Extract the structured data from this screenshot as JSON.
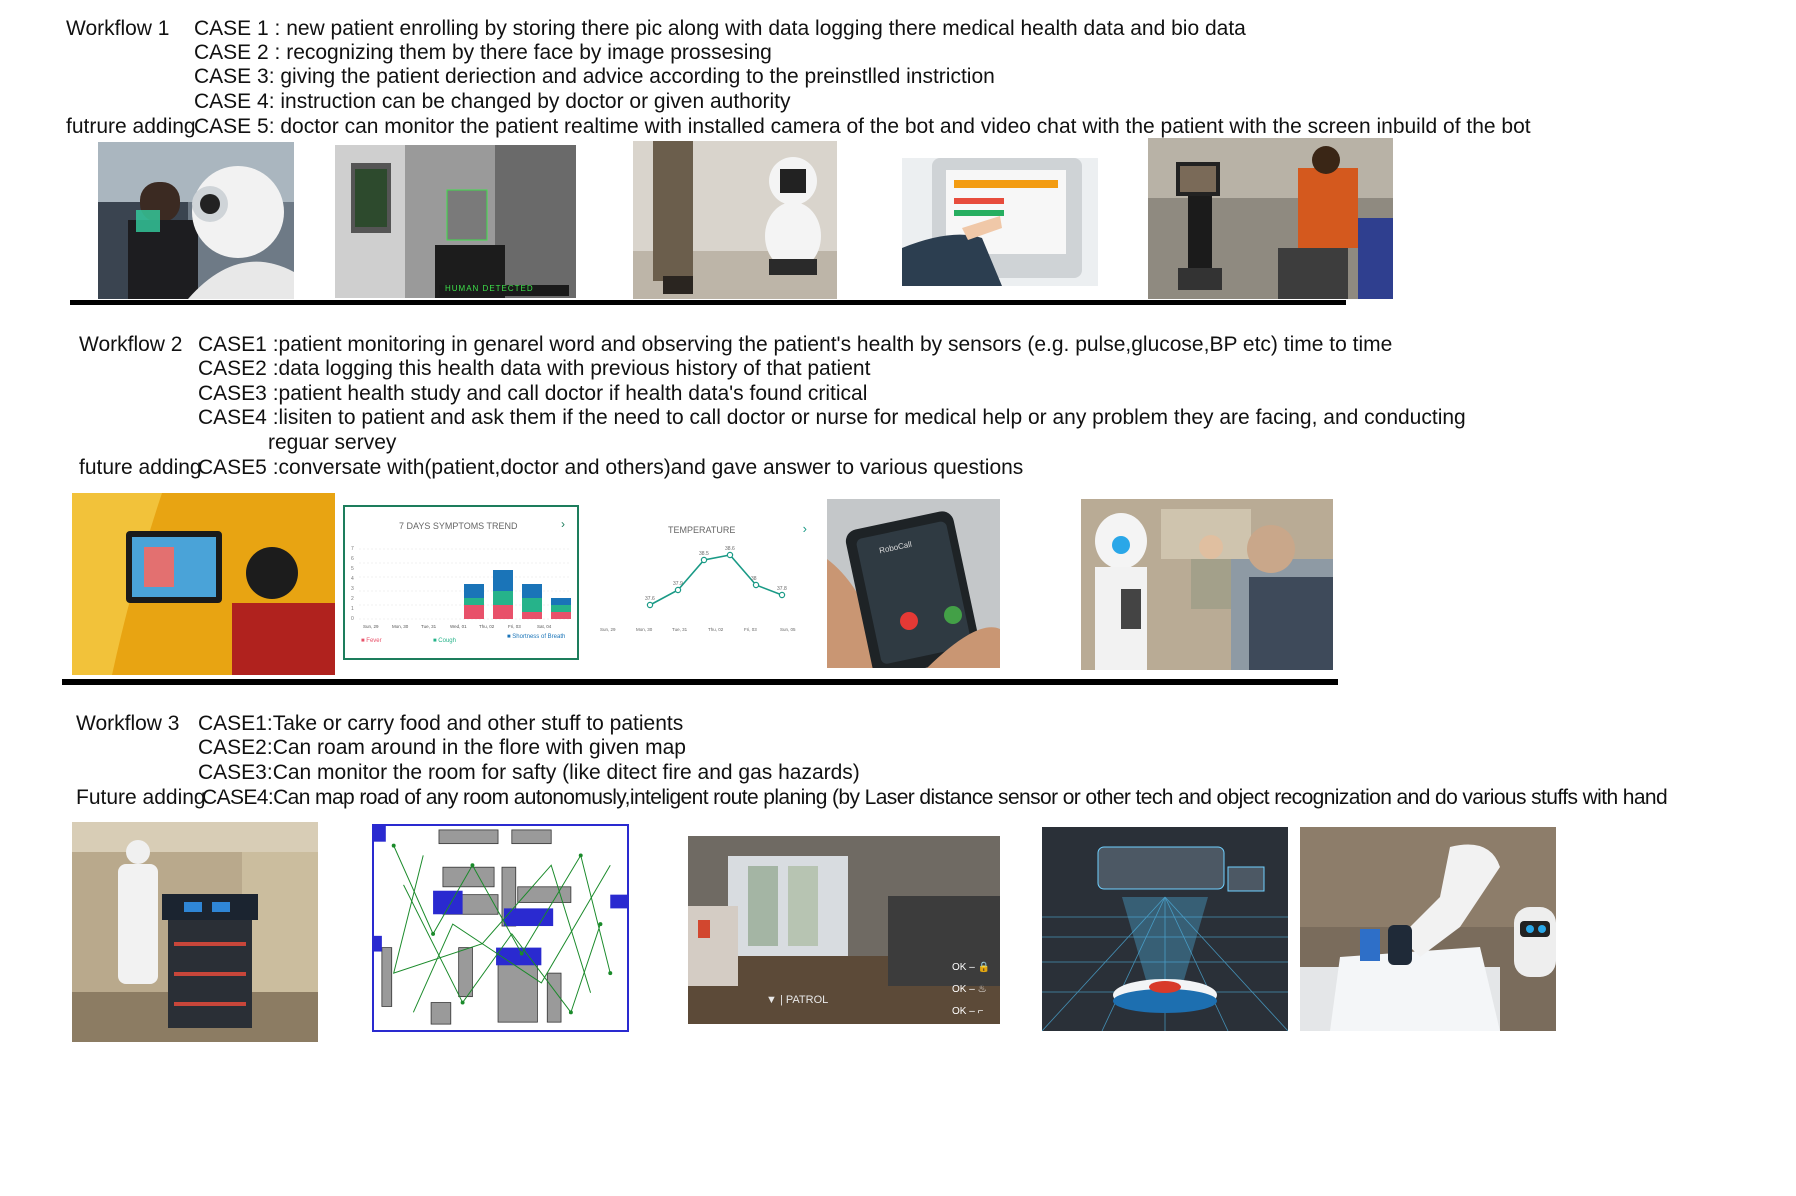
{
  "workflow1": {
    "label": "Workflow  1",
    "future_label": "futrure adding",
    "cases": [
      "CASE 1 : new patient enrolling by storing there pic along with data logging there medical health data and bio data",
      "CASE 2 : recognizing them by there face by image prossesing",
      "CASE 3:  giving the patient deriection and advice according to the preinstlled instriction",
      "CASE 4:  instruction can be changed by doctor or given authority",
      "CASE 5:  doctor can monitor the patient realtime with installed camera of the bot and video chat with the patient with the screen inbuild of the bot"
    ],
    "image_texts": {
      "human_detected": "HUMAN DETECTED"
    }
  },
  "workflow2": {
    "label": "Workflow 2",
    "future_label": "future adding",
    "cases": [
      "CASE1   :patient monitoring  in genarel word and observing the patient's health by sensors (e.g. pulse,glucose,BP etc) time to time",
      "CASE2   :data logging this health data with previous history of that patient",
      "CASE3   :patient health study and call doctor if health data's found critical",
      "CASE4   :lisiten to patient and ask them if the need to call doctor or nurse for medical help or any problem they are facing, and conducting",
      "reguar servey",
      "CASE5   :conversate with(patient,doctor and others)and gave answer to various questions"
    ],
    "symptoms_chart": {
      "title": "7 DAYS SYMPTOMS TREND",
      "days": [
        "Sun, 29",
        "Mon, 30",
        "Tue, 31",
        "Wed, 01",
        "Thu, 02",
        "Fri, 03",
        "Sat, 04"
      ],
      "y_ticks": [
        "7",
        "6",
        "5",
        "4",
        "3",
        "2",
        "1",
        "0"
      ],
      "legend": [
        "Fever",
        "Cough",
        "Shortness of Breath"
      ],
      "colors": {
        "fever": "#e8516a",
        "cough": "#26b38a",
        "breath": "#1a74b8"
      }
    },
    "temperature_chart": {
      "title": "TEMPERATURE",
      "days": [
        "Sun, 29",
        "Mon, 30",
        "Tue, 31",
        "Thu, 02",
        "Fri, 03",
        "Sun, 05"
      ],
      "values": [
        37.6,
        37.9,
        38.5,
        38.6,
        38,
        37.8
      ],
      "color": "#1a9a86"
    },
    "phone_text": "RoboCall"
  },
  "workflow3": {
    "label": "Workflow 3",
    "future_label": "Future adding",
    "cases": [
      "CASE1:Take or carry food and other stuff to patients",
      "CASE2:Can roam around in the flore with given map",
      "CASE3:Can monitor the room for safty (like ditect fire and gas hazards)",
      "CASE4:Can map road of any room autonomusly,inteligent route planing (by Laser distance sensor or other tech and object recognization and do various stuffs with hand"
    ],
    "patrol_label": "PATROL",
    "ok_labels": [
      "OK",
      "OK",
      "OK"
    ]
  }
}
